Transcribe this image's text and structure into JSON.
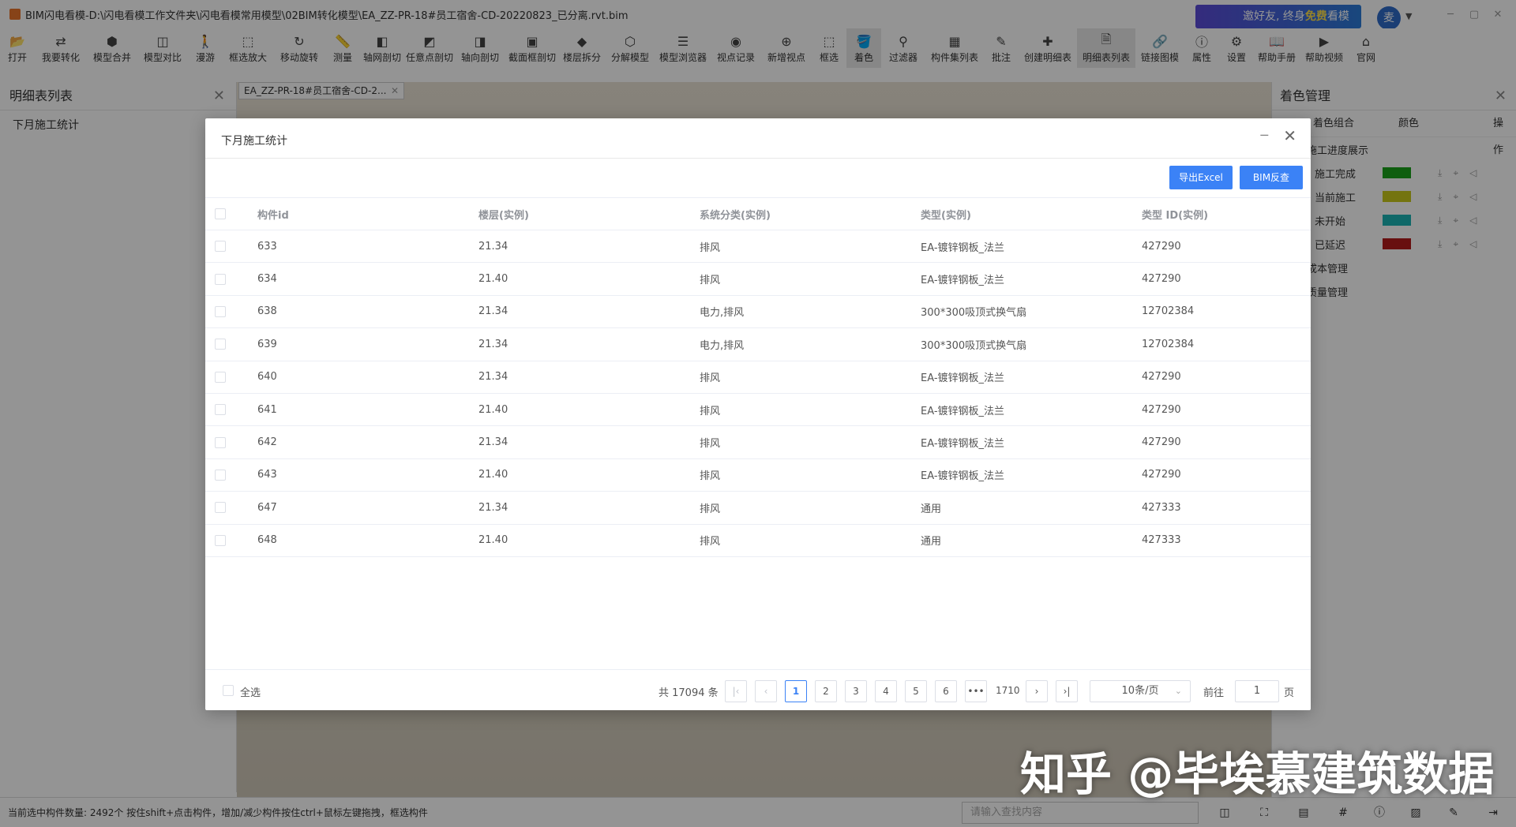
{
  "window": {
    "title": "BIM闪电看模-D:\\闪电看模工作文件夹\\闪电看模常用模型\\02BIM转化模型\\EA_ZZ-PR-18#员工宿舍-CD-20220823_已分离.rvt.bim",
    "ad_text_prefix": "邀好友, 终身",
    "ad_text_highlight": "免费",
    "ad_text_suffix": "看模",
    "user_initial": "麦",
    "btn_minimize": "─",
    "btn_maximize": "▢",
    "btn_close": "✕"
  },
  "toolbar": {
    "items": [
      {
        "label": "打开",
        "icon": "folder-icon",
        "glyph": "📂"
      },
      {
        "label": "我要转化",
        "icon": "convert-icon",
        "glyph": "⇄"
      },
      {
        "label": "模型合并",
        "icon": "merge-icon",
        "glyph": "⬢"
      },
      {
        "label": "模型对比",
        "icon": "compare-icon",
        "glyph": "◫"
      },
      {
        "label": "漫游",
        "icon": "walk-icon",
        "glyph": "🚶"
      },
      {
        "label": "框选放大",
        "icon": "zoom-box-icon",
        "glyph": "⬚"
      },
      {
        "label": "移动旋转",
        "icon": "rotate-icon",
        "glyph": "↻"
      },
      {
        "label": "测量",
        "icon": "measure-icon",
        "glyph": "📏"
      },
      {
        "label": "轴网剖切",
        "icon": "grid-section-icon",
        "glyph": "◧"
      },
      {
        "label": "任意点剖切",
        "icon": "point-section-icon",
        "glyph": "◩"
      },
      {
        "label": "轴向剖切",
        "icon": "axis-section-icon",
        "glyph": "◨"
      },
      {
        "label": "截面框剖切",
        "icon": "box-section-icon",
        "glyph": "▣"
      },
      {
        "label": "楼层拆分",
        "icon": "floor-split-icon",
        "glyph": "◆"
      },
      {
        "label": "分解模型",
        "icon": "explode-icon",
        "glyph": "⬡"
      },
      {
        "label": "模型浏览器",
        "icon": "browser-icon",
        "glyph": "☰"
      },
      {
        "label": "视点记录",
        "icon": "viewpoint-icon",
        "glyph": "◉"
      },
      {
        "label": "新增视点",
        "icon": "add-viewpoint-icon",
        "glyph": "⊕"
      },
      {
        "label": "框选",
        "icon": "select-box-icon",
        "glyph": "⬚"
      },
      {
        "label": "着色",
        "icon": "paint-icon",
        "glyph": "🪣"
      },
      {
        "label": "过滤器",
        "icon": "filter-icon",
        "glyph": "⚲"
      },
      {
        "label": "构件集列表",
        "icon": "component-list-icon",
        "glyph": "▦"
      },
      {
        "label": "批注",
        "icon": "annotate-icon",
        "glyph": "✎"
      },
      {
        "label": "创建明细表",
        "icon": "create-schedule-icon",
        "glyph": "✚"
      },
      {
        "label": "明细表列表",
        "icon": "schedule-list-icon",
        "glyph": "🗎"
      },
      {
        "label": "链接图模",
        "icon": "link-icon",
        "glyph": "🔗"
      },
      {
        "label": "属性",
        "icon": "info-icon",
        "glyph": "ⓘ"
      },
      {
        "label": "设置",
        "icon": "gear-icon",
        "glyph": "⚙"
      },
      {
        "label": "帮助手册",
        "icon": "manual-icon",
        "glyph": "📖"
      },
      {
        "label": "帮助视频",
        "icon": "video-icon",
        "glyph": "▶"
      },
      {
        "label": "官网",
        "icon": "home-icon",
        "glyph": "⌂"
      }
    ]
  },
  "left_panel": {
    "title": "明细表列表",
    "items": [
      "下月施工统计"
    ]
  },
  "viewport": {
    "tab_label": "EA_ZZ-PR-18#员工宿舍-CD-2..."
  },
  "right_panel": {
    "title": "着色管理",
    "columns": [
      "着色组合",
      "颜色",
      "操作"
    ],
    "groups": [
      {
        "label": "施工进度展示",
        "color": ""
      },
      {
        "label": "施工完成",
        "color": "#1aa31a"
      },
      {
        "label": "当前施工",
        "color": "#c8c81a"
      },
      {
        "label": "未开始",
        "color": "#1ab4b4"
      },
      {
        "label": "已延迟",
        "color": "#b41a1a"
      },
      {
        "label": "成本管理",
        "color": ""
      },
      {
        "label": "质量管理",
        "color": ""
      }
    ]
  },
  "dialog": {
    "title": "下月施工统计",
    "export_label": "导出Excel",
    "bim_lookup_label": "BIM反查",
    "columns": [
      "构件id",
      "楼层(实例)",
      "系统分类(实例)",
      "类型(实例)",
      "类型 ID(实例)"
    ],
    "rows": [
      [
        "633",
        "21.34",
        "排风",
        "EA-镀锌钢板_法兰",
        "427290"
      ],
      [
        "634",
        "21.40",
        "排风",
        "EA-镀锌钢板_法兰",
        "427290"
      ],
      [
        "638",
        "21.34",
        "电力,排风",
        "300*300吸顶式换气扇",
        "12702384"
      ],
      [
        "639",
        "21.34",
        "电力,排风",
        "300*300吸顶式换气扇",
        "12702384"
      ],
      [
        "640",
        "21.34",
        "排风",
        "EA-镀锌钢板_法兰",
        "427290"
      ],
      [
        "641",
        "21.40",
        "排风",
        "EA-镀锌钢板_法兰",
        "427290"
      ],
      [
        "642",
        "21.34",
        "排风",
        "EA-镀锌钢板_法兰",
        "427290"
      ],
      [
        "643",
        "21.40",
        "排风",
        "EA-镀锌钢板_法兰",
        "427290"
      ],
      [
        "647",
        "21.34",
        "排风",
        "通用",
        "427333"
      ],
      [
        "648",
        "21.40",
        "排风",
        "通用",
        "427333"
      ]
    ],
    "select_all_label": "全选",
    "total_label": "共 17094 条",
    "pages": [
      "1",
      "2",
      "3",
      "4",
      "5",
      "6",
      "•••",
      "1710"
    ],
    "current_page": "1",
    "page_size": "10条/页",
    "goto_label": "前往",
    "goto_value": "1",
    "goto_unit": "页"
  },
  "statusbar": {
    "message": "当前选中构件数量: 2492个 按住shift+点击构件，增加/减少构件按住ctrl+鼠标左键拖拽，框选构件",
    "search_placeholder": "请输入查找内容"
  },
  "watermark": "知乎 @毕埃慕建筑数据"
}
